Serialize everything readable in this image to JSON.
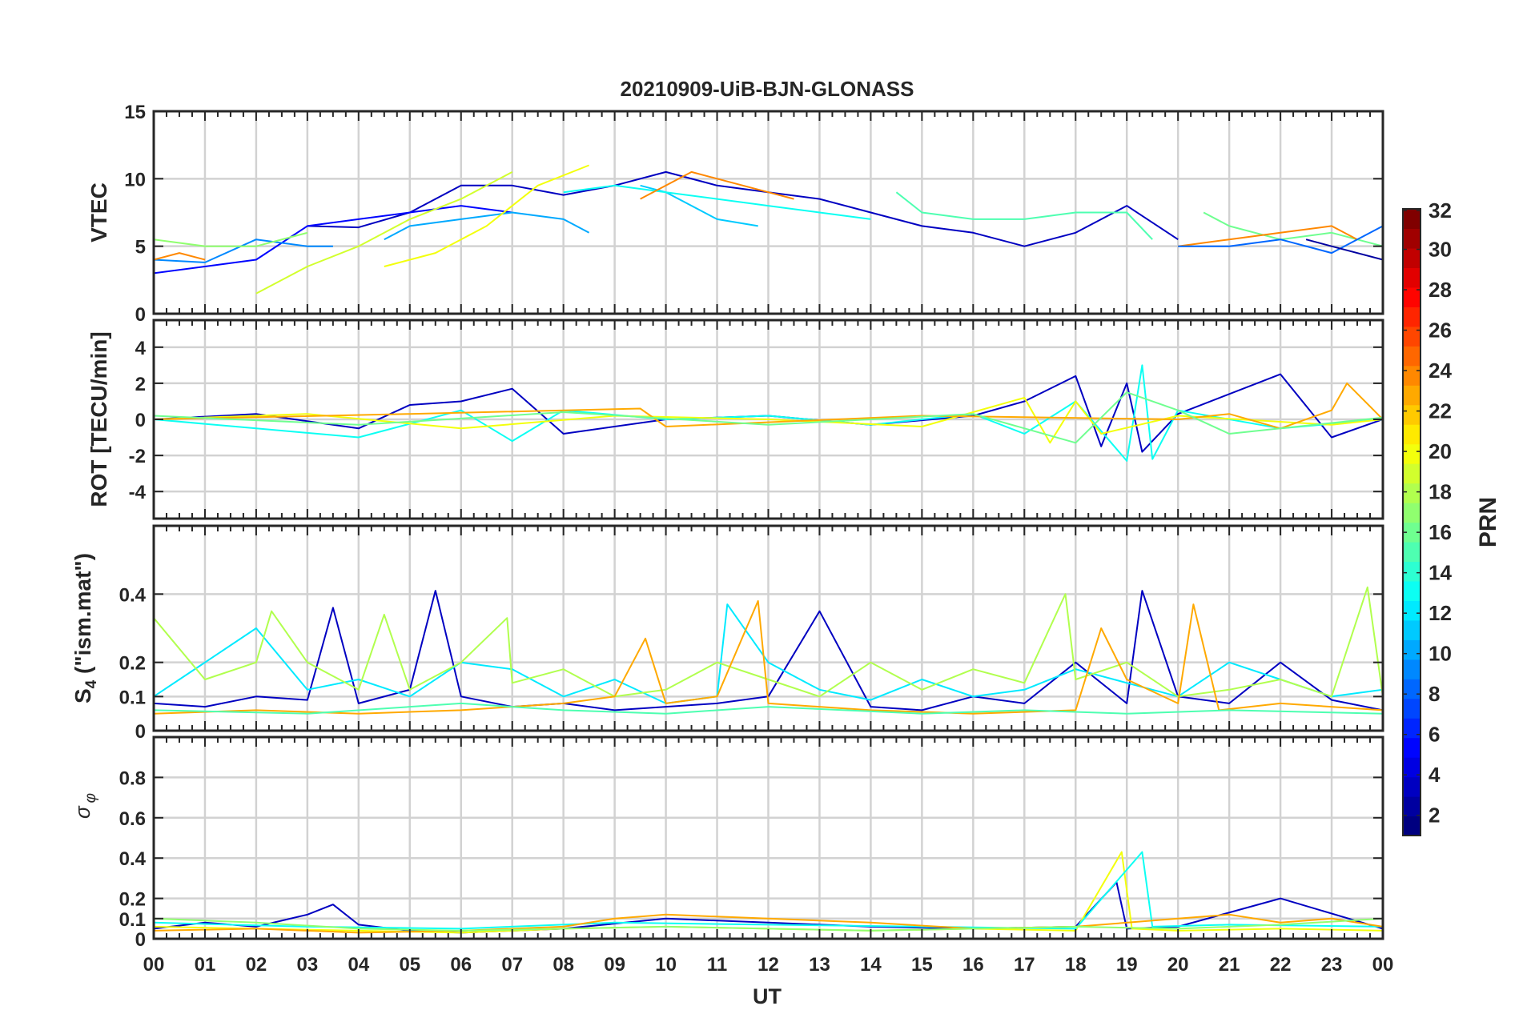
{
  "chart_data": {
    "type": "line",
    "title": "20210909-UiB-BJN-GLONASS",
    "xlabel": "UT",
    "x_ticks": [
      "00",
      "01",
      "02",
      "03",
      "04",
      "05",
      "06",
      "07",
      "08",
      "09",
      "10",
      "11",
      "12",
      "13",
      "14",
      "15",
      "16",
      "17",
      "18",
      "19",
      "20",
      "21",
      "22",
      "23",
      "00"
    ],
    "xlim": [
      0,
      24
    ],
    "grid": true,
    "colormap": "jet",
    "series_note": "multiple satellite traces colored by PRN",
    "panels": [
      {
        "id": "vtec",
        "ylabel": "VTEC",
        "ylim": [
          0,
          15
        ],
        "y_ticks": [
          0,
          5,
          10,
          15
        ],
        "y_tick_labels": [
          "0",
          "5",
          "10",
          "15"
        ],
        "series": [
          {
            "prn": 3,
            "x": [
              3.0,
              4.0,
              5.0,
              6.0,
              7.0,
              8.0,
              9.0,
              10.0,
              11.0,
              12.0,
              13.0,
              14.0,
              15.0,
              16.0,
              17.0,
              18.0,
              19.0,
              20.0
            ],
            "y": [
              6.5,
              6.4,
              7.5,
              9.5,
              9.5,
              8.8,
              9.5,
              10.5,
              9.5,
              9.0,
              8.5,
              7.5,
              6.5,
              6.0,
              5.0,
              6.0,
              8.0,
              5.5
            ]
          },
          {
            "prn": 5,
            "x": [
              0.0,
              1.0,
              2.0,
              3.0,
              4.0,
              5.0,
              6.0,
              7.0
            ],
            "y": [
              3.0,
              3.5,
              4.0,
              6.5,
              7.0,
              7.5,
              8.0,
              7.5
            ]
          },
          {
            "prn": 9,
            "x": [
              0.0,
              1.0,
              2.0,
              3.0,
              3.5
            ],
            "y": [
              4.0,
              3.8,
              5.5,
              5.0,
              5.0
            ]
          },
          {
            "prn": 10,
            "x": [
              4.5,
              5.0,
              6.0,
              7.0,
              8.0,
              8.5
            ],
            "y": [
              5.5,
              6.5,
              7.0,
              7.5,
              7.0,
              6.0
            ]
          },
          {
            "prn": 11,
            "x": [
              9.5,
              10.0,
              11.0,
              11.8
            ],
            "y": [
              9.5,
              9.0,
              7.0,
              6.5
            ]
          },
          {
            "prn": 13,
            "x": [
              8.0,
              9.0,
              10.0,
              11.0,
              12.0,
              13.0,
              14.0
            ],
            "y": [
              9.0,
              9.5,
              9.0,
              8.5,
              8.0,
              7.5,
              7.0
            ]
          },
          {
            "prn": 15,
            "x": [
              14.5,
              15.0,
              16.0,
              17.0,
              18.0,
              19.0,
              19.5
            ],
            "y": [
              9.0,
              7.5,
              7.0,
              7.0,
              7.5,
              7.5,
              5.5
            ]
          },
          {
            "prn": 17,
            "x": [
              0.0,
              1.0,
              2.0,
              3.0
            ],
            "y": [
              5.5,
              5.0,
              5.0,
              6.0
            ]
          },
          {
            "prn": 19,
            "x": [
              2.0,
              3.0,
              4.0,
              5.0,
              6.0,
              7.0
            ],
            "y": [
              1.5,
              3.5,
              5.0,
              7.0,
              8.5,
              10.5
            ]
          },
          {
            "prn": 20,
            "x": [
              4.5,
              5.5,
              6.5,
              7.5,
              8.5
            ],
            "y": [
              3.5,
              4.5,
              6.5,
              9.5,
              11.0
            ]
          },
          {
            "prn": 16,
            "x": [
              20.5,
              21.0,
              22.0,
              23.0,
              24.0
            ],
            "y": [
              7.5,
              6.5,
              5.5,
              6.0,
              5.0
            ]
          },
          {
            "prn": 24,
            "x": [
              0.0,
              0.5,
              1.0
            ],
            "y": [
              4.0,
              4.5,
              4.0
            ]
          },
          {
            "prn": 24,
            "x": [
              9.5,
              10.0,
              10.5,
              11.0,
              12.0,
              12.5
            ],
            "y": [
              8.5,
              9.5,
              10.5,
              10.0,
              9.0,
              8.5
            ]
          },
          {
            "prn": 24,
            "x": [
              20.0,
              21.0,
              22.0,
              23.0,
              23.5
            ],
            "y": [
              5.0,
              5.5,
              6.0,
              6.5,
              5.5
            ]
          },
          {
            "prn": 8,
            "x": [
              20.0,
              21.0,
              22.0,
              23.0,
              24.0
            ],
            "y": [
              5.0,
              5.0,
              5.5,
              4.5,
              6.5
            ]
          },
          {
            "prn": 2,
            "x": [
              22.5,
              23.0,
              24.0
            ],
            "y": [
              5.5,
              5.0,
              4.0
            ]
          }
        ]
      },
      {
        "id": "rot",
        "ylabel": "ROT [TECU/min]",
        "ylim": [
          -5.5,
          5.5
        ],
        "y_ticks": [
          -4,
          -2,
          0,
          2,
          4
        ],
        "y_tick_labels": [
          "-4",
          "-2",
          "0",
          "2",
          "4"
        ],
        "series": [
          {
            "prn": 3,
            "x": [
              0,
              2,
              4,
              5,
              6,
              7,
              8,
              10,
              12,
              14,
              16,
              17,
              18,
              18.5,
              19,
              19.3,
              20,
              22,
              23,
              24
            ],
            "y": [
              0,
              0.3,
              -0.5,
              0.8,
              1.0,
              1.7,
              -0.8,
              0,
              0.2,
              -0.3,
              0.2,
              1.0,
              2.4,
              -1.5,
              2.0,
              -1.8,
              0.3,
              2.5,
              -1.0,
              0
            ]
          },
          {
            "prn": 13,
            "x": [
              0,
              2,
              4,
              6,
              7,
              8,
              10,
              12,
              14,
              16,
              17,
              18,
              19,
              19.3,
              19.5,
              20,
              22,
              24
            ],
            "y": [
              0,
              -0.5,
              -1.0,
              0.5,
              -1.2,
              0.5,
              0,
              0.2,
              -0.3,
              0.3,
              -0.8,
              1.0,
              -2.3,
              3.0,
              -2.2,
              0.5,
              -0.5,
              0
            ]
          },
          {
            "prn": 20,
            "x": [
              0,
              3,
              6,
              9,
              12,
              15,
              17,
              17.5,
              18,
              18.5,
              20,
              23,
              24
            ],
            "y": [
              0,
              0.3,
              -0.5,
              0.2,
              0,
              -0.4,
              1.2,
              -1.3,
              1.0,
              -0.8,
              0.2,
              -0.3,
              0
            ]
          },
          {
            "prn": 23,
            "x": [
              0,
              5,
              9.5,
              10,
              15,
              20,
              21,
              22,
              23,
              23.3,
              24
            ],
            "y": [
              0,
              0.3,
              0.6,
              -0.4,
              0.2,
              0,
              0.3,
              -0.5,
              0.5,
              2.0,
              0
            ]
          },
          {
            "prn": 16,
            "x": [
              0,
              4,
              8,
              12,
              16,
              18,
              19,
              20,
              21,
              24
            ],
            "y": [
              0.2,
              -0.3,
              0.4,
              -0.3,
              0.3,
              -1.3,
              1.5,
              0.5,
              -0.8,
              0.1
            ]
          }
        ]
      },
      {
        "id": "s4",
        "ylabel_main": "S",
        "ylabel_sub": "4",
        "ylabel_rest": " (\"ism.mat\")",
        "ylim": [
          0,
          0.6
        ],
        "y_ticks": [
          0,
          0.1,
          0.2,
          0.4
        ],
        "y_tick_labels": [
          "0",
          "0.1",
          "0.2",
          "0.4"
        ],
        "series": [
          {
            "prn": 3,
            "x": [
              0,
              1,
              2,
              3,
              3.5,
              4,
              5,
              5.5,
              6,
              7,
              8,
              9,
              10,
              11,
              12,
              13,
              14,
              15,
              16,
              17,
              18,
              19,
              19.3,
              20,
              21,
              22,
              23,
              24
            ],
            "y": [
              0.08,
              0.07,
              0.1,
              0.09,
              0.36,
              0.08,
              0.12,
              0.41,
              0.1,
              0.07,
              0.08,
              0.06,
              0.07,
              0.08,
              0.1,
              0.35,
              0.07,
              0.06,
              0.1,
              0.08,
              0.2,
              0.08,
              0.41,
              0.1,
              0.08,
              0.2,
              0.09,
              0.06
            ]
          },
          {
            "prn": 12,
            "x": [
              0,
              1,
              2,
              3,
              4,
              5,
              6,
              7,
              8,
              9,
              10,
              11,
              11.2,
              12,
              13,
              14,
              15,
              16,
              17,
              18,
              19,
              20,
              21,
              22,
              23,
              24
            ],
            "y": [
              0.1,
              0.2,
              0.3,
              0.12,
              0.15,
              0.1,
              0.2,
              0.18,
              0.1,
              0.15,
              0.08,
              0.1,
              0.37,
              0.2,
              0.12,
              0.09,
              0.15,
              0.1,
              0.12,
              0.18,
              0.14,
              0.1,
              0.2,
              0.15,
              0.1,
              0.12
            ]
          },
          {
            "prn": 18,
            "x": [
              0,
              1,
              2,
              2.3,
              3,
              4,
              4.5,
              5,
              6,
              6.9,
              7,
              8,
              9,
              10,
              11,
              12,
              13,
              14,
              15,
              16,
              17,
              17.8,
              18,
              19,
              20,
              21,
              22,
              23,
              23.7,
              24
            ],
            "y": [
              0.33,
              0.15,
              0.2,
              0.35,
              0.2,
              0.12,
              0.34,
              0.12,
              0.2,
              0.33,
              0.14,
              0.18,
              0.1,
              0.12,
              0.2,
              0.15,
              0.1,
              0.2,
              0.12,
              0.18,
              0.14,
              0.4,
              0.15,
              0.2,
              0.1,
              0.12,
              0.15,
              0.1,
              0.42,
              0.1
            ]
          },
          {
            "prn": 23,
            "x": [
              0,
              2,
              4,
              6,
              8,
              9,
              9.6,
              10,
              11,
              11.8,
              12,
              14,
              16,
              18,
              18.5,
              19,
              20,
              20.3,
              20.8,
              22,
              24
            ],
            "y": [
              0.05,
              0.06,
              0.05,
              0.06,
              0.08,
              0.1,
              0.27,
              0.08,
              0.1,
              0.38,
              0.08,
              0.06,
              0.05,
              0.06,
              0.3,
              0.15,
              0.08,
              0.37,
              0.06,
              0.08,
              0.06
            ]
          },
          {
            "prn": 15,
            "x": [
              0,
              3,
              6,
              8,
              10,
              12,
              15,
              17,
              19,
              21,
              24
            ],
            "y": [
              0.06,
              0.05,
              0.08,
              0.06,
              0.05,
              0.07,
              0.05,
              0.06,
              0.05,
              0.06,
              0.05
            ]
          }
        ]
      },
      {
        "id": "sigma_phi",
        "ylabel": "σ",
        "ylabel_sub": "φ",
        "ylim": [
          0,
          1.0
        ],
        "y_ticks": [
          0,
          0.1,
          0.2,
          0.4,
          0.6,
          0.8
        ],
        "y_tick_labels": [
          "0",
          "0.1",
          "0.2",
          "0.4",
          "0.6",
          "0.8"
        ],
        "series": [
          {
            "prn": 3,
            "x": [
              0,
              1,
              2,
              3,
              3.5,
              4,
              5,
              6,
              8,
              10,
              12,
              14,
              16,
              18,
              18.8,
              19,
              20,
              22,
              24
            ],
            "y": [
              0.05,
              0.08,
              0.06,
              0.12,
              0.17,
              0.07,
              0.04,
              0.03,
              0.05,
              0.1,
              0.08,
              0.06,
              0.05,
              0.06,
              0.28,
              0.05,
              0.06,
              0.2,
              0.05
            ]
          },
          {
            "prn": 20,
            "x": [
              0,
              2,
              4,
              6,
              8,
              10,
              12,
              14,
              16,
              18,
              18.9,
              19.1,
              20,
              22,
              24
            ],
            "y": [
              0.06,
              0.05,
              0.04,
              0.03,
              0.05,
              0.06,
              0.05,
              0.04,
              0.05,
              0.04,
              0.43,
              0.05,
              0.04,
              0.05,
              0.04
            ]
          },
          {
            "prn": 13,
            "x": [
              0,
              3,
              6,
              9,
              12,
              15,
              18,
              19.3,
              19.5,
              21,
              24
            ],
            "y": [
              0.08,
              0.06,
              0.05,
              0.08,
              0.07,
              0.06,
              0.05,
              0.43,
              0.06,
              0.07,
              0.06
            ]
          },
          {
            "prn": 23,
            "x": [
              0,
              2,
              4,
              6,
              8,
              9,
              10,
              12,
              14,
              16,
              18,
              20,
              21,
              22,
              23,
              24
            ],
            "y": [
              0.04,
              0.05,
              0.03,
              0.04,
              0.06,
              0.1,
              0.12,
              0.1,
              0.08,
              0.05,
              0.06,
              0.1,
              0.12,
              0.08,
              0.1,
              0.06
            ]
          },
          {
            "prn": 17,
            "x": [
              0,
              2,
              4,
              6,
              8,
              10,
              12,
              14,
              16,
              18,
              20,
              22,
              24
            ],
            "y": [
              0.1,
              0.08,
              0.05,
              0.04,
              0.05,
              0.06,
              0.05,
              0.04,
              0.05,
              0.06,
              0.05,
              0.07,
              0.1
            ]
          }
        ]
      }
    ],
    "colorbar": {
      "label": "PRN",
      "range": [
        1,
        32
      ],
      "tick_values": [
        2,
        4,
        6,
        8,
        10,
        12,
        14,
        16,
        18,
        20,
        22,
        24,
        26,
        28,
        30,
        32
      ],
      "tick_labels": [
        "2",
        "4",
        "6",
        "8",
        "10",
        "12",
        "14",
        "16",
        "18",
        "20",
        "22",
        "24",
        "26",
        "28",
        "30",
        "32"
      ]
    }
  }
}
